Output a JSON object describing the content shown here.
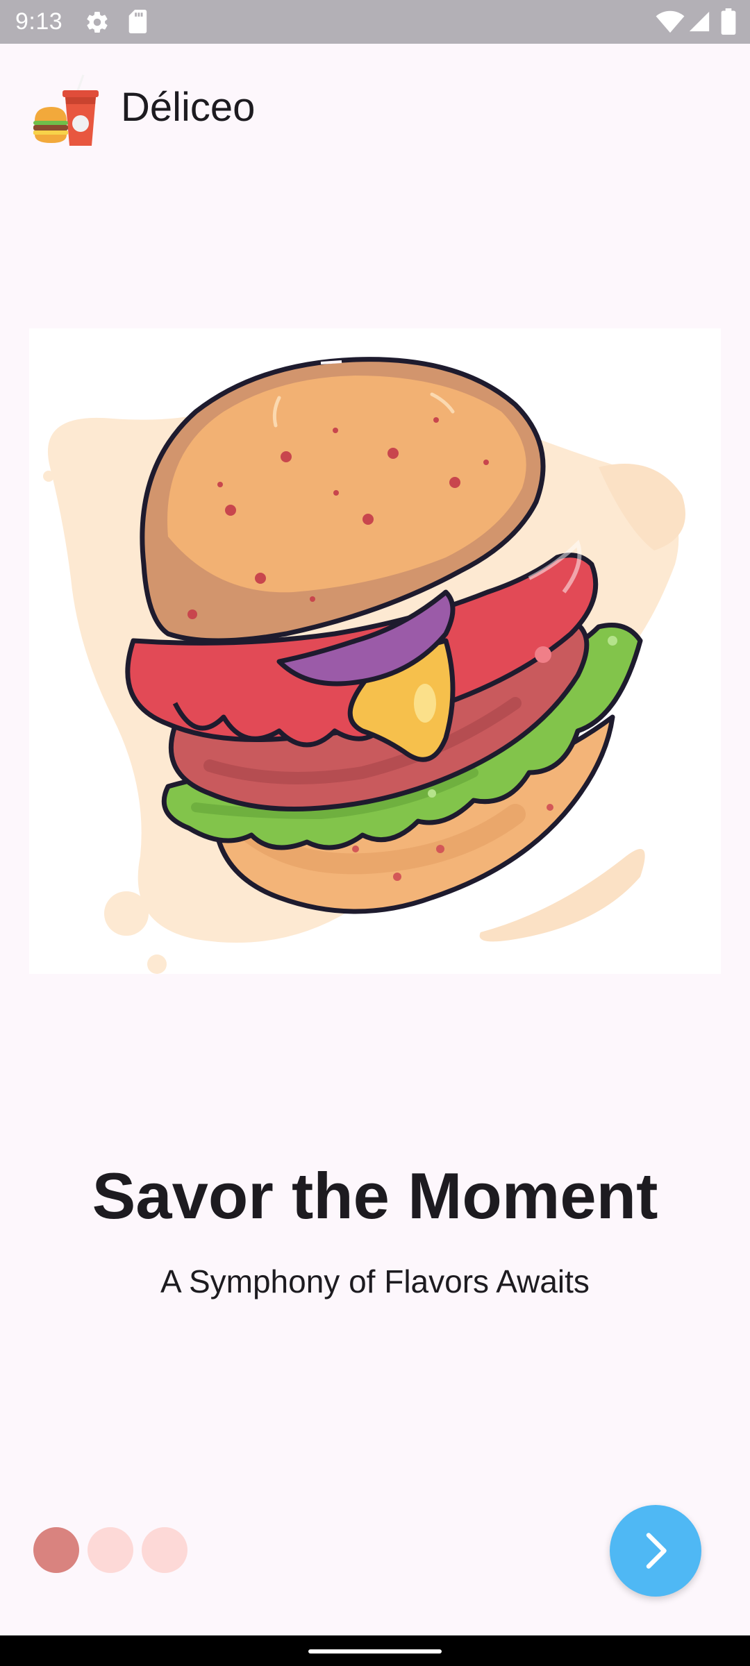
{
  "status_bar": {
    "time": "9:13",
    "icons": [
      "gear-icon",
      "sd-card-icon",
      "wifi-icon",
      "cell-signal-icon",
      "battery-icon"
    ]
  },
  "app": {
    "title": "Déliceo",
    "logo_icon": "burger-and-drink-logo"
  },
  "onboarding": {
    "illustration": "burger-illustration",
    "headline": "Savor the Moment",
    "subheadline": "A Symphony of Flavors Awaits",
    "page_count": 3,
    "current_page": 1,
    "next_icon": "chevron-right-icon"
  },
  "colors": {
    "background": "#fdf7fc",
    "status_bar": "#b3b0b6",
    "dot_active": "#d9837f",
    "dot_inactive": "#fdd9d7",
    "next_button": "#4fb8f4",
    "text": "#1d1b20"
  }
}
